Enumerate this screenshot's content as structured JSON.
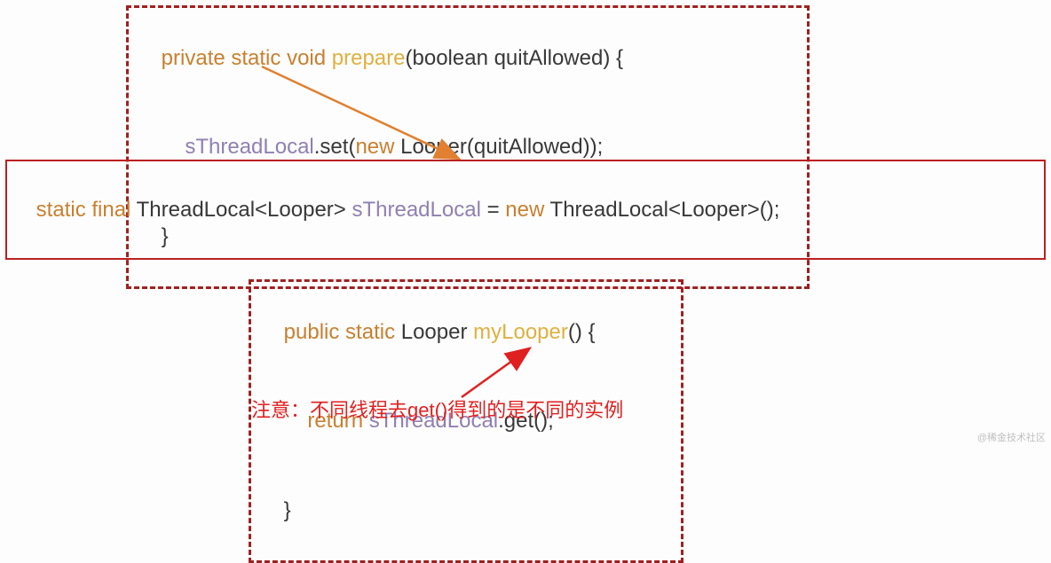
{
  "box1": {
    "l1_private": "private ",
    "l1_static": "static ",
    "l1_void": "void ",
    "l1_prepare": "prepare",
    "l1_params": "(boolean quitAllowed) {",
    "l2_indent": "    ",
    "l2_var": "sThreadLocal",
    "l2_dotset": ".set(",
    "l2_new": "new ",
    "l2_rest": "Looper(quitAllowed));",
    "l3_close": "}"
  },
  "box2": {
    "static": "static ",
    "final": "final ",
    "type": "ThreadLocal<Looper> ",
    "var": "sThreadLocal",
    "eq": " = ",
    "new": "new ",
    "rest": "ThreadLocal<Looper>();"
  },
  "box3": {
    "l1_public": "public ",
    "l1_static": "static ",
    "l1_type": "Looper ",
    "l1_fn": "myLooper",
    "l1_paren": "() {",
    "l2_indent": "    ",
    "l2_return": "return ",
    "l2_var": "sThreadLocal",
    "l2_rest": ".get();",
    "l3_close": "}"
  },
  "annotation": "注意：不同线程去get()得到的是不同的实例",
  "watermark": "@稀金技术社区"
}
